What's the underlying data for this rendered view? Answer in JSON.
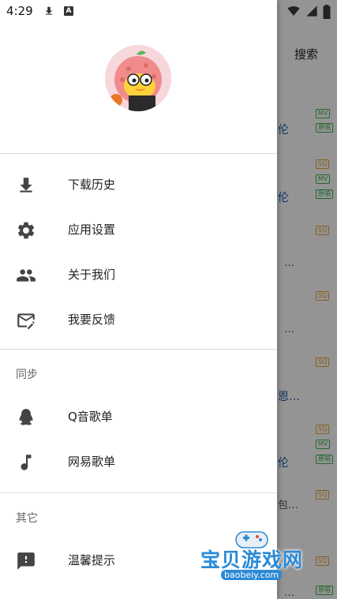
{
  "status_bar": {
    "time": "4:29",
    "left_icons": [
      "download-icon",
      "a-icon"
    ],
    "a_glyph": "A",
    "right_icons": [
      "wifi-icon",
      "signal-icon",
      "battery-icon"
    ]
  },
  "background_app": {
    "search_label": "搜索",
    "snippets": [
      "伦",
      "伦",
      "…",
      "…",
      "恩…",
      "伦",
      "包…",
      "…"
    ],
    "tags": {
      "mv": "MV",
      "sq": "SQ",
      "yc": "原唱"
    }
  },
  "drawer": {
    "avatar": "avatar-image",
    "menu": [
      {
        "label": "下载历史",
        "icon": "download-icon"
      },
      {
        "label": "应用设置",
        "icon": "gear-icon"
      },
      {
        "label": "关于我们",
        "icon": "people-icon"
      },
      {
        "label": "我要反馈",
        "icon": "feedback-icon"
      }
    ],
    "sync_section": {
      "title": "同步",
      "items": [
        {
          "label": "Q音歌单",
          "icon": "qq-penguin-icon"
        },
        {
          "label": "网易歌单",
          "icon": "music-note-icon"
        }
      ]
    },
    "other_section": {
      "title": "其它",
      "items": [
        {
          "label": "温馨提示",
          "icon": "alert-message-icon"
        }
      ]
    }
  },
  "watermark": {
    "text": "宝贝游戏网",
    "url": "baobeiy.com"
  },
  "colors": {
    "background": "#ffffff",
    "text_primary": "#222222",
    "section_title": "#666666",
    "icon": "#444444",
    "link_blue": "#1a5aa8",
    "tag_green": "#3fb34f",
    "tag_orange": "#f0a030",
    "watermark_blue": "#2b8ad6"
  }
}
